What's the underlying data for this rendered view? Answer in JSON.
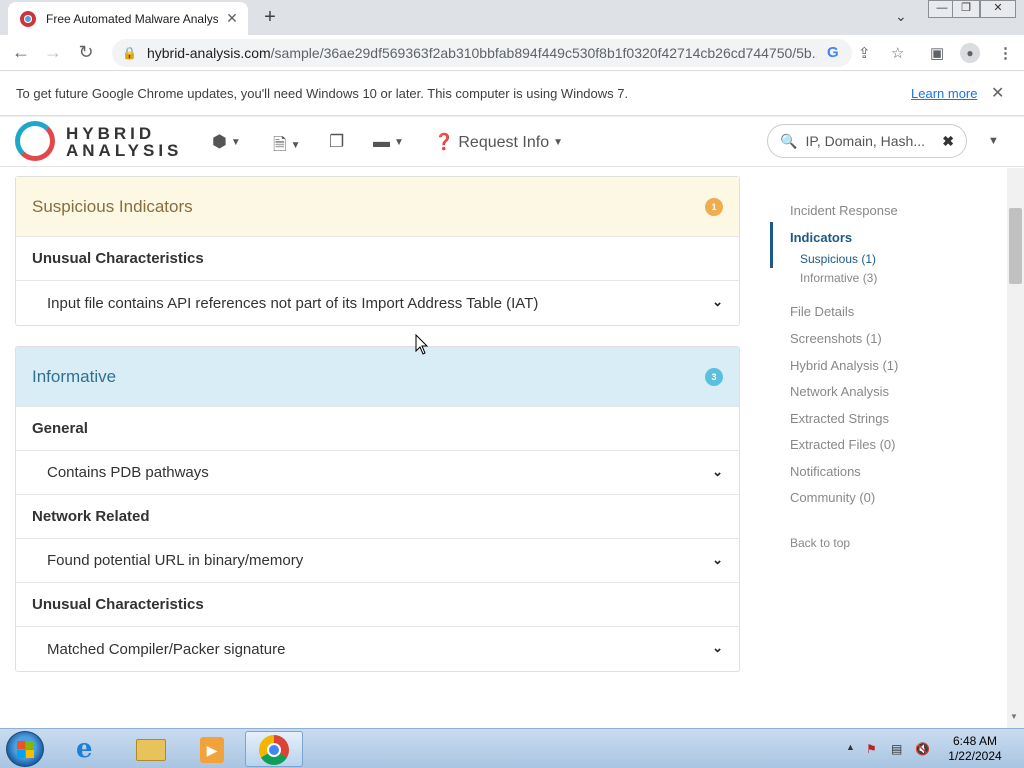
{
  "browser": {
    "tab_title": "Free Automated Malware Analysis",
    "tab_close": "✕",
    "new_tab": "+",
    "window_controls": [
      "—",
      "❐",
      "✕"
    ],
    "url_domain": "hybrid-analysis.com",
    "url_path": "/sample/36ae29df569363f2ab310bbfab894f449c530f8b1f0320f42714cb26cd744750/5b...",
    "info_message": "To get future Google Chrome updates, you'll need Windows 10 or later. This computer is using Windows 7.",
    "info_link": "Learn more"
  },
  "site": {
    "logo_line1": "HYBRID",
    "logo_line2": "ANALYSIS",
    "request_info": "Request Info",
    "search_placeholder": "IP, Domain, Hash..."
  },
  "sections": {
    "suspicious": {
      "title": "Suspicious Indicators",
      "badge": "1",
      "color": "#fcf8e3",
      "title_color": "#8a6d3b",
      "badge_color": "#f0ad4e",
      "groups": [
        {
          "category": "Unusual Characteristics",
          "items": [
            "Input file contains API references not part of its Import Address Table (IAT)"
          ]
        }
      ]
    },
    "informative": {
      "title": "Informative",
      "badge": "3",
      "color": "#d9edf7",
      "title_color": "#31708f",
      "badge_color": "#5bc0de",
      "groups": [
        {
          "category": "General",
          "items": [
            "Contains PDB pathways"
          ]
        },
        {
          "category": "Network Related",
          "items": [
            "Found potential URL in binary/memory"
          ]
        },
        {
          "category": "Unusual Characteristics",
          "items": [
            "Matched Compiler/Packer signature"
          ]
        }
      ]
    }
  },
  "sidenav": {
    "incident_response": "Incident Response",
    "indicators": "Indicators",
    "suspicious": "Suspicious (1)",
    "informative": "Informative (3)",
    "file_details": "File Details",
    "screenshots": "Screenshots (1)",
    "hybrid_analysis": "Hybrid Analysis (1)",
    "network_analysis": "Network Analysis",
    "extracted_strings": "Extracted Strings",
    "extracted_files": "Extracted Files (0)",
    "notifications": "Notifications",
    "community": "Community (0)",
    "back_to_top": "Back to top"
  },
  "taskbar": {
    "time": "6:48 AM",
    "date": "1/22/2024"
  }
}
